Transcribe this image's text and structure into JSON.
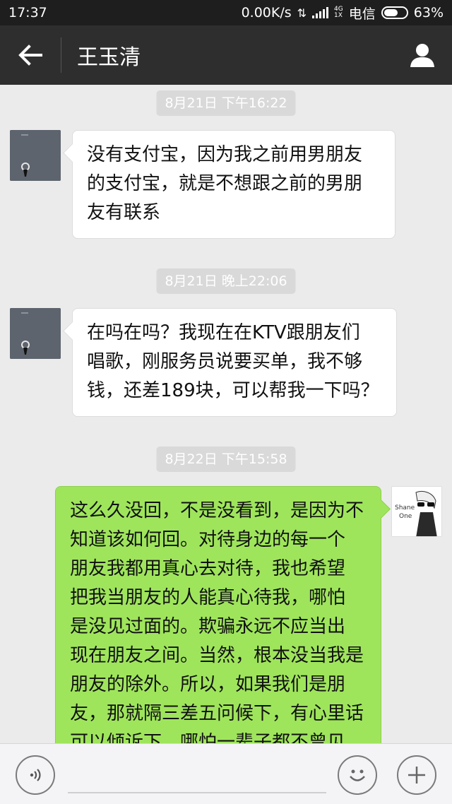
{
  "status_bar": {
    "time": "17:37",
    "network_speed": "0.00K/s",
    "network_type_top": "4G",
    "network_type_bottom": "1X",
    "carrier": "电信",
    "battery": "63%",
    "battery_level": 0.63
  },
  "header": {
    "back_icon": "arrow-left-icon",
    "title": "王玉清",
    "contact_icon": "person-icon"
  },
  "messages": [
    {
      "type": "timestamp",
      "text": "8月21日 下午16:22"
    },
    {
      "type": "message",
      "sender": "them",
      "lines": [
        "没有支付宝，因为我之前用男朋友",
        "的支付宝，就是不想跟之前的男朋",
        "友有联系"
      ]
    },
    {
      "type": "timestamp",
      "text": "8月21日 晚上22:06"
    },
    {
      "type": "message",
      "sender": "them",
      "lines": [
        "在吗在吗？我现在在KTV跟朋友们",
        "唱歌，刚服务员说要买单，我不够",
        "钱，还差189块，可以帮我一下吗？"
      ]
    },
    {
      "type": "timestamp",
      "text": "8月22日 下午15:58"
    },
    {
      "type": "message",
      "sender": "me",
      "avatar_text": "Shane One",
      "lines": [
        "这么久没回，不是没看到，是因为不",
        "知道该如何回。对待身边的每一个",
        "朋友我都用真心去对待，我也希望",
        "把我当朋友的人能真心待我，哪怕",
        "是没见过面的。欺骗永远不应当出",
        "现在朋友之间。当然，根本没当我是",
        "朋友的除外。所以，如果我们是朋",
        "友，那就隔三差五问候下，有心里话",
        "可以倾诉下，哪怕一辈子都不曾见"
      ]
    }
  ],
  "input_bar": {
    "voice_icon": "voice-icon",
    "input_value": "",
    "emoji_icon": "smiley-icon",
    "plus_icon": "plus-icon"
  }
}
